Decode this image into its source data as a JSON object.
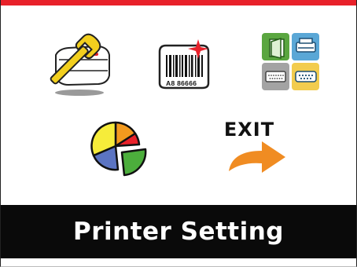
{
  "screen": {
    "title": "Printer Setting",
    "accent_color": "#e8212a",
    "title_bar_color": "#0a0a0a"
  },
  "menu": {
    "items": [
      {
        "icon": "tools-icon"
      },
      {
        "icon": "barcode-label-icon",
        "barcode_text": "A8 86666"
      },
      {
        "icon": "interface-icon"
      },
      {
        "icon": "pie-chart-icon"
      },
      {
        "icon": "exit-arrow-icon",
        "label": "EXIT"
      }
    ]
  }
}
